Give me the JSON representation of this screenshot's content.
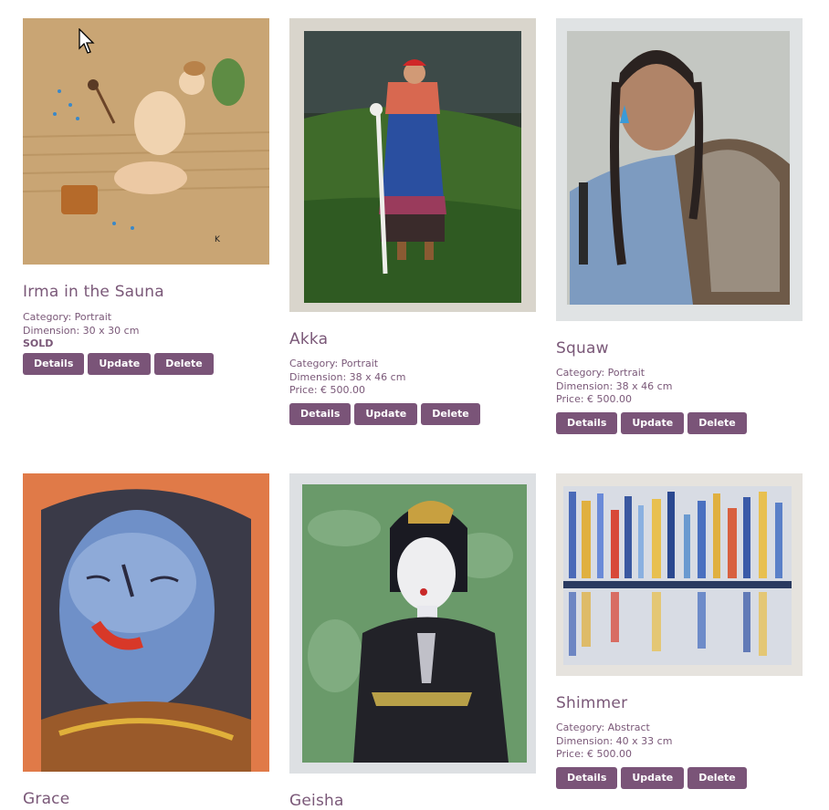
{
  "artworks": [
    {
      "title": "Irma in the Sauna",
      "category": "Category: Portrait",
      "dimension": "Dimension: 30 x 30 cm",
      "status": "SOLD",
      "buttons": [
        "Details",
        "Update",
        "Delete"
      ]
    },
    {
      "title": "Akka",
      "category": "Category: Portrait",
      "dimension": "Dimension: 38 x 46 cm",
      "price": "Price: € 500.00",
      "buttons": [
        "Details",
        "Update",
        "Delete"
      ]
    },
    {
      "title": "Squaw",
      "category": "Category: Portrait",
      "dimension": "Dimension: 38 x 46 cm",
      "price": "Price: € 500.00",
      "buttons": [
        "Details",
        "Update",
        "Delete"
      ]
    },
    {
      "title": "Grace"
    },
    {
      "title": "Geisha"
    },
    {
      "title": "Shimmer",
      "category": "Category: Abstract",
      "dimension": "Dimension: 40 x 33 cm",
      "price": "Price: € 500.00",
      "buttons": [
        "Details",
        "Update",
        "Delete"
      ]
    }
  ],
  "colors": {
    "accent": "#7a5478",
    "title_text": "#7a5878"
  }
}
